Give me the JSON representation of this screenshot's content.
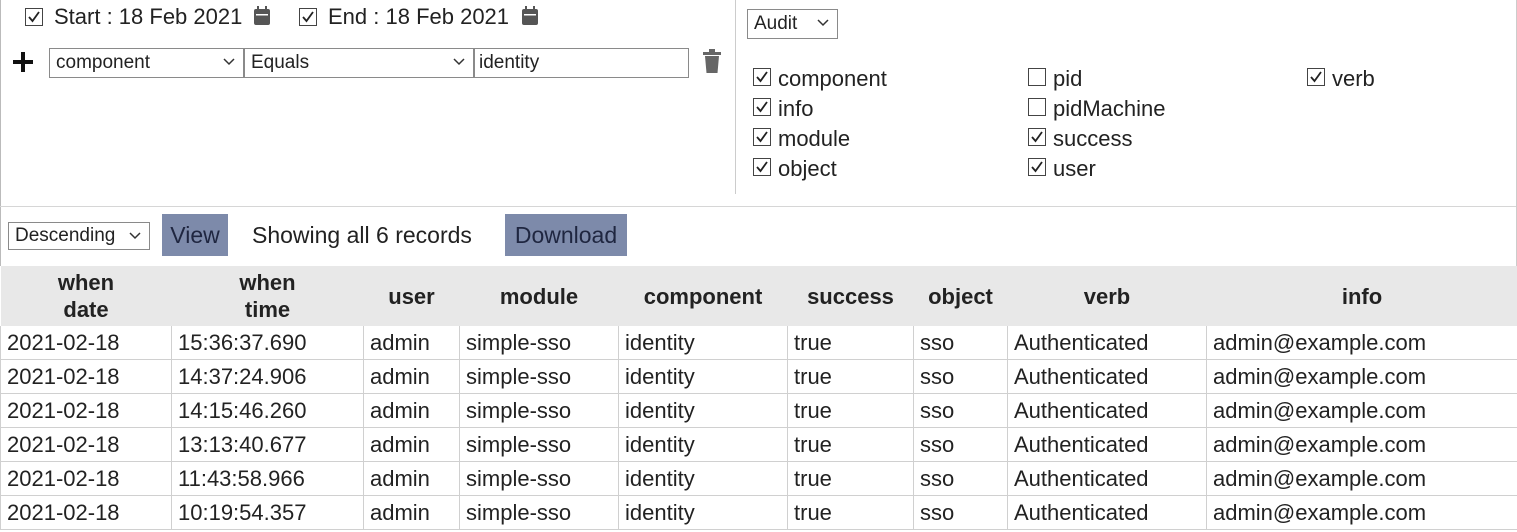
{
  "dates": {
    "start_label": "Start : 18 Feb 2021",
    "end_label": "End : 18 Feb 2021",
    "start_checked": true,
    "end_checked": true
  },
  "filter": {
    "field": "component",
    "operator": "Equals",
    "value": "identity"
  },
  "audit_select": "Audit",
  "columns_toggle": [
    {
      "label": "component",
      "checked": true
    },
    {
      "label": "info",
      "checked": true
    },
    {
      "label": "module",
      "checked": true
    },
    {
      "label": "object",
      "checked": true
    },
    {
      "label": "pid",
      "checked": false
    },
    {
      "label": "pidMachine",
      "checked": false
    },
    {
      "label": "success",
      "checked": true
    },
    {
      "label": "user",
      "checked": true
    },
    {
      "label": "verb",
      "checked": true
    }
  ],
  "toolbar": {
    "order": "Descending",
    "view_label": "View",
    "status": "Showing all 6 records",
    "download_label": "Download"
  },
  "table": {
    "headers": [
      {
        "line1": "when",
        "line2": "date"
      },
      {
        "line1": "when",
        "line2": "time"
      },
      {
        "line1": "user",
        "line2": ""
      },
      {
        "line1": "module",
        "line2": ""
      },
      {
        "line1": "component",
        "line2": ""
      },
      {
        "line1": "success",
        "line2": ""
      },
      {
        "line1": "object",
        "line2": ""
      },
      {
        "line1": "verb",
        "line2": ""
      },
      {
        "line1": "info",
        "line2": ""
      }
    ],
    "rows": [
      [
        "2021-02-18",
        "15:36:37.690",
        "admin",
        "simple-sso",
        "identity",
        "true",
        "sso",
        "Authenticated",
        "admin@example.com"
      ],
      [
        "2021-02-18",
        "14:37:24.906",
        "admin",
        "simple-sso",
        "identity",
        "true",
        "sso",
        "Authenticated",
        "admin@example.com"
      ],
      [
        "2021-02-18",
        "14:15:46.260",
        "admin",
        "simple-sso",
        "identity",
        "true",
        "sso",
        "Authenticated",
        "admin@example.com"
      ],
      [
        "2021-02-18",
        "13:13:40.677",
        "admin",
        "simple-sso",
        "identity",
        "true",
        "sso",
        "Authenticated",
        "admin@example.com"
      ],
      [
        "2021-02-18",
        "11:43:58.966",
        "admin",
        "simple-sso",
        "identity",
        "true",
        "sso",
        "Authenticated",
        "admin@example.com"
      ],
      [
        "2021-02-18",
        "10:19:54.357",
        "admin",
        "simple-sso",
        "identity",
        "true",
        "sso",
        "Authenticated",
        "admin@example.com"
      ]
    ]
  }
}
